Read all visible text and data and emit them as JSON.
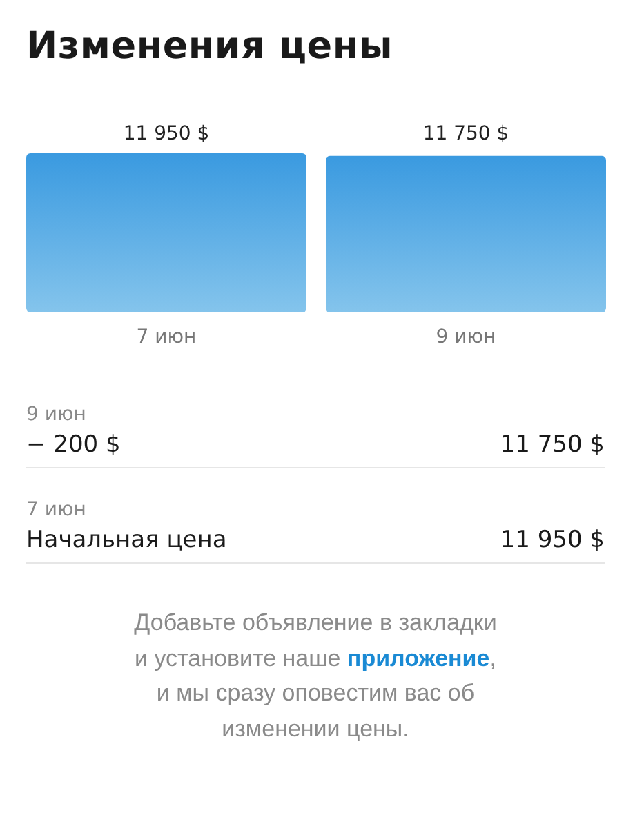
{
  "title": "Изменения цены",
  "chart_data": {
    "type": "bar",
    "categories": [
      "7 июн",
      "9 июн"
    ],
    "values": [
      11950,
      11750
    ],
    "value_labels": [
      "11 950 $",
      "11 750 $"
    ]
  },
  "history": [
    {
      "date": "9 июн",
      "change": "− 200 $",
      "price": "11 750 $"
    },
    {
      "date": "7 июн",
      "change": "Начальная цена",
      "price": "11 950 $"
    }
  ],
  "note": {
    "before": "Добавьте объявление в закладки и установите наше ",
    "link": "приложение",
    "after": ", и мы сразу оповестим вас об изменении цены."
  }
}
